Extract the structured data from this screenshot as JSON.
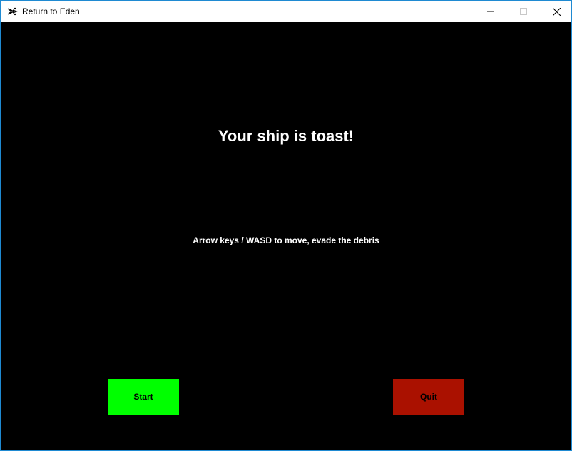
{
  "window": {
    "title": "Return to Eden",
    "icon": "spaceship-icon",
    "controls": [
      "minimize-icon",
      "maximize-icon",
      "close-icon"
    ]
  },
  "game": {
    "heading": "Your ship is toast!",
    "instructions": "Arrow keys / WASD to move, evade the debris",
    "start_label": "Start",
    "quit_label": "Quit"
  },
  "colors": {
    "background": "#000000",
    "text": "#ffffff",
    "start_button": "#00ff00",
    "quit_button": "#aa1100"
  }
}
